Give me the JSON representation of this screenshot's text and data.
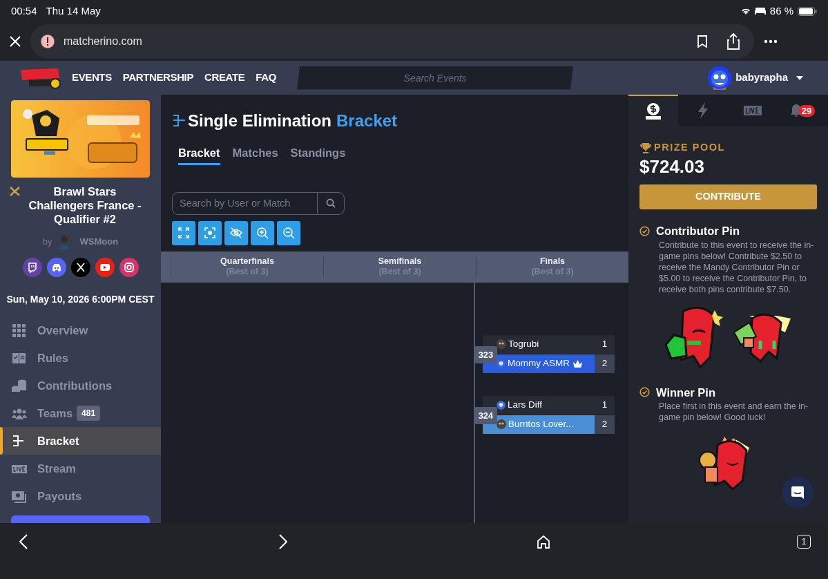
{
  "status_bar": {
    "time": "00:54",
    "date": "Thu 14 May",
    "battery": "86 %"
  },
  "browser": {
    "url": "matcherino.com",
    "tab_count": "1"
  },
  "nav": {
    "items": [
      "EVENTS",
      "PARTNERSHIP",
      "CREATE",
      "FAQ"
    ],
    "search_placeholder": "Search Events",
    "user": "babyrapha"
  },
  "event": {
    "title": "Brawl Stars Challengers France - Qualifier #2",
    "by": "by",
    "author": "WSMoon",
    "socials": [
      {
        "kind": "twitch"
      },
      {
        "kind": "discord"
      },
      {
        "kind": "x"
      },
      {
        "kind": "youtube"
      },
      {
        "kind": "instagram"
      }
    ],
    "date": "Sun, May 10, 2026 6:00PM CEST"
  },
  "sidebar": {
    "items": [
      {
        "label": "Overview",
        "kind": "grid",
        "selected": false
      },
      {
        "label": "Rules",
        "kind": "rules",
        "selected": false
      },
      {
        "label": "Contributions",
        "kind": "coins",
        "selected": false
      },
      {
        "label": "Teams",
        "kind": "team",
        "selected": false,
        "badge": "481"
      },
      {
        "label": "Bracket",
        "kind": "bracket",
        "selected": true
      },
      {
        "label": "Stream",
        "kind": "live",
        "selected": false
      },
      {
        "label": "Payouts",
        "kind": "money",
        "selected": false
      }
    ]
  },
  "main": {
    "title": "Single Elimination",
    "title_accent": "Bracket",
    "tabs": [
      {
        "label": "Bracket",
        "selected": true
      },
      {
        "label": "Matches",
        "selected": false
      },
      {
        "label": "Standings",
        "selected": false
      }
    ],
    "search_placeholder": "Search by User or Match",
    "tools": [
      {
        "kind": "expand"
      },
      {
        "kind": "focus"
      },
      {
        "kind": "hide"
      },
      {
        "kind": "zoom-in"
      },
      {
        "kind": "zoom-out"
      }
    ],
    "rounds": [
      {
        "name": "Quarterfinals",
        "subtitle": "(Best of 3)"
      },
      {
        "name": "Semifinals",
        "subtitle": "(Best of 3)"
      },
      {
        "name": "Finals",
        "subtitle": "(Best of 3)"
      }
    ],
    "matches": [
      {
        "id": "323",
        "players": [
          {
            "name": "Togrubi",
            "score": "1",
            "winner": false
          },
          {
            "name": "Mommy ASMR",
            "score": "2",
            "winner": true,
            "crown": true,
            "color": "#2b5de0",
            "avatar": {
              "kind": "shield"
            }
          }
        ]
      },
      {
        "id": "324",
        "players": [
          {
            "name": "Lars Diff",
            "score": "1",
            "winner": false,
            "avatar": {
              "kind": "shield"
            }
          },
          {
            "name": "Burritos Lover...",
            "score": "2",
            "winner": true,
            "crown": false,
            "color": "#4a8fd6"
          }
        ]
      }
    ]
  },
  "panel": {
    "tabs": [
      {
        "kind": "prize",
        "selected": true
      },
      {
        "kind": "bolt",
        "selected": false
      },
      {
        "kind": "live",
        "selected": false
      },
      {
        "kind": "bell",
        "selected": false,
        "badge": "29"
      }
    ],
    "prize_label": "PRIZE POOL",
    "prize_amount": "$724.03",
    "button": "CONTRIBUTE",
    "pins": [
      {
        "title": "Contributor Pin",
        "description": "Contribute to this event to receive the in-game pins below! Contribute $2.50 to receive the Mandy Contributor Pin or $5.00 to receive the Contributor Pin, to receive both pins contribute $7.50."
      },
      {
        "title": "Winner Pin",
        "description": "Place first in this event and earn the in-game pin below! Good luck!"
      }
    ]
  }
}
